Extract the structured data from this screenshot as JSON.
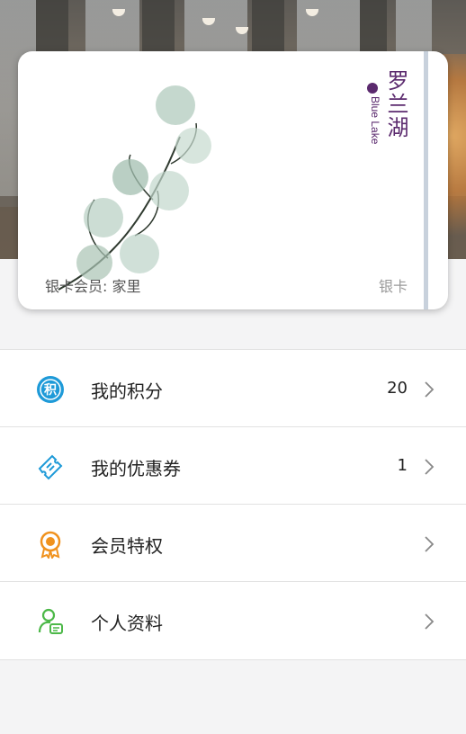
{
  "card": {
    "member_label": "银卡会员: 家里",
    "tier": "银卡",
    "brand_cn": "罗兰湖",
    "brand_en": "Blue Lake"
  },
  "menu": {
    "items": [
      {
        "label": "我的积分",
        "value": "20",
        "icon": "points-icon",
        "color": "#1e9ad8"
      },
      {
        "label": "我的优惠券",
        "value": "1",
        "icon": "coupon-icon",
        "color": "#1e9ad8"
      },
      {
        "label": "会员特权",
        "value": "",
        "icon": "badge-icon",
        "color": "#f0921e"
      },
      {
        "label": "个人资料",
        "value": "",
        "icon": "profile-icon",
        "color": "#4cb848"
      }
    ]
  }
}
